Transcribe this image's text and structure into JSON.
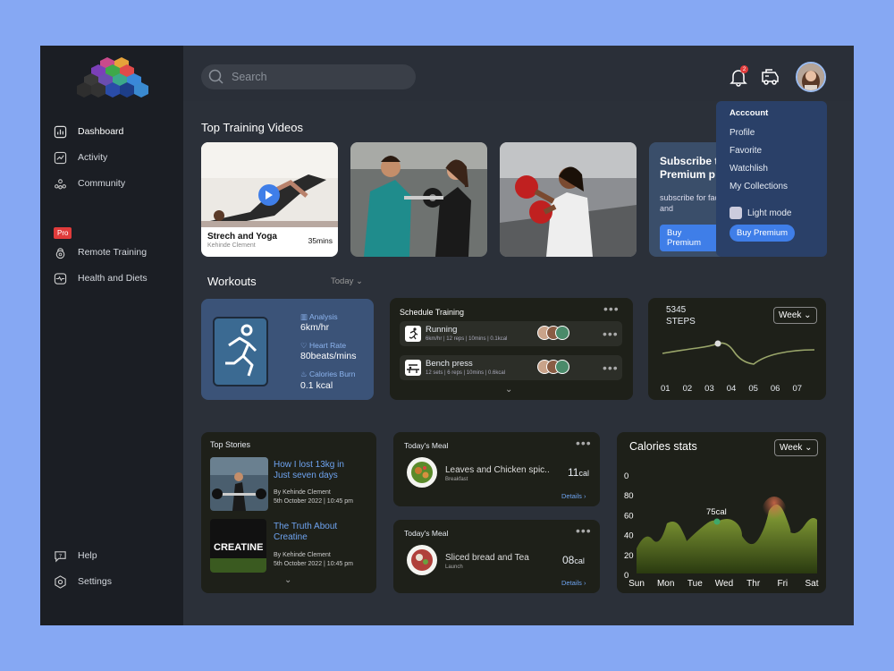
{
  "search": {
    "placeholder": "Search"
  },
  "notifications": {
    "count": "2"
  },
  "sidebar": {
    "items": [
      {
        "label": "Dashboard"
      },
      {
        "label": "Activity"
      },
      {
        "label": "Community"
      },
      {
        "label": "Remote Training"
      },
      {
        "label": "Health and Diets"
      }
    ],
    "pro_badge": "Pro",
    "help": "Help",
    "settings": "Settings"
  },
  "account_menu": {
    "title": "Acccount",
    "items": [
      "Profile",
      "Favorite",
      "Watchlish",
      "My Collections"
    ],
    "light_mode": "Light mode",
    "buy_premium": "Buy Premium"
  },
  "videos": {
    "title": "Top Training Videos",
    "first": {
      "name": "Strech and Yoga",
      "author": "Kehinde Clement",
      "duration": "35mins"
    },
    "subscribe": {
      "heading": "Subscribe to Premium p",
      "text": "subscribe for facilities and",
      "button": "Buy Premium"
    }
  },
  "workouts": {
    "title": "Workouts",
    "filter": "Today",
    "analysis": {
      "analysis_label": "Analysis",
      "analysis_value": "6km/hr",
      "heart_label": "Heart Rate",
      "heart_value": "80beats/mins",
      "calories_label": "Calories Burn",
      "calories_value": "0.1 kcal"
    },
    "schedule": {
      "title": "Schedule Training",
      "items": [
        {
          "name": "Running",
          "meta": "6km/hr | 12 reps | 10mins | 0.1kcal"
        },
        {
          "name": "Bench press",
          "meta": "12 sets | 6 reps | 10mins | 0.6kcal"
        }
      ]
    },
    "steps": {
      "value": "5345",
      "label": "STEPS",
      "period": "Week",
      "days": [
        "01",
        "02",
        "03",
        "04",
        "05",
        "06",
        "07"
      ]
    }
  },
  "stories": {
    "title": "Top Stories",
    "items": [
      {
        "title": "How I lost 13kg in Just seven days",
        "author": "By Kehinde Clement",
        "date": "5th October 2022 | 10:45 pm"
      },
      {
        "title": "The Truth About Creatine",
        "author": "By Kehinde Clement",
        "date": "5th October 2022 | 10:45 pm",
        "image_text": "CREATINE"
      }
    ]
  },
  "meals": [
    {
      "title": "Today's Meal",
      "name": "Leaves and Chicken spic..",
      "type": "Breakfast",
      "cal_value": "11",
      "cal_unit": "cal",
      "details": "Details"
    },
    {
      "title": "Today's Meal",
      "name": "Sliced bread and Tea",
      "type": "Launch",
      "cal_value": "08",
      "cal_unit": "cal",
      "details": "Details"
    }
  ],
  "calories": {
    "title": "Calories stats",
    "period": "Week",
    "highlight": "75cal",
    "colors": {
      "fill_top": "#8ea83a",
      "fill_bottom": "#2a3a10",
      "accent": "#3fa86a"
    }
  },
  "chart_data": {
    "type": "area",
    "title": "Calories stats",
    "categories": [
      "Sun",
      "Mon",
      "Tue",
      "Wed",
      "Thr",
      "Fri",
      "Sat"
    ],
    "yticks": [
      "0",
      "80",
      "60",
      "40",
      "20",
      "0"
    ],
    "annotation": "75cal",
    "ylim": [
      0,
      100
    ]
  }
}
